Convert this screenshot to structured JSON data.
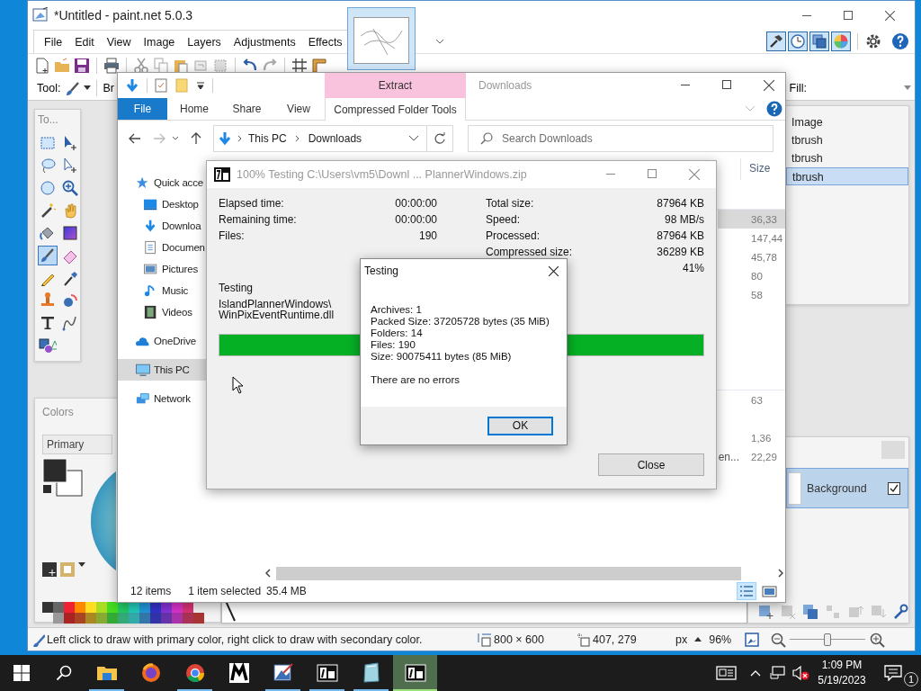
{
  "paint_window": {
    "title": "*Untitled - paint.net 5.0.3",
    "menu": [
      "File",
      "Edit",
      "View",
      "Image",
      "Layers",
      "Adjustments",
      "Effects"
    ],
    "panel_toggles": [
      {
        "kind": "tools",
        "on": true
      },
      {
        "kind": "history",
        "on": true
      },
      {
        "kind": "layers",
        "on": true
      },
      {
        "kind": "colors",
        "on": true
      }
    ],
    "tool_label": "Tool:",
    "brush_label": "Br",
    "fill_label": "Fill:",
    "tools_panel": {
      "title": "To...",
      "tools": [
        {
          "kind": "marquee",
          "selected": false
        },
        {
          "kind": "move",
          "selected": false
        },
        {
          "kind": "lasso",
          "selected": false
        },
        {
          "kind": "moveselection",
          "selected": false
        },
        {
          "kind": "ellipse",
          "selected": false
        },
        {
          "kind": "zoom",
          "selected": false
        },
        {
          "kind": "wand",
          "selected": false
        },
        {
          "kind": "pan",
          "selected": false
        },
        {
          "kind": "bucket",
          "selected": false
        },
        {
          "kind": "gradient",
          "selected": false
        },
        {
          "kind": "brush",
          "selected": true
        },
        {
          "kind": "eraser",
          "selected": false
        },
        {
          "kind": "pencil",
          "selected": false
        },
        {
          "kind": "picker",
          "selected": false
        },
        {
          "kind": "stamp",
          "selected": false
        },
        {
          "kind": "recolor",
          "selected": false
        },
        {
          "kind": "text",
          "selected": false
        },
        {
          "kind": "line",
          "selected": false
        },
        {
          "kind": "shapes",
          "selected": false
        }
      ]
    },
    "colors_panel": {
      "title": "Colors",
      "mode": "Primary"
    },
    "history": [
      {
        "label": "Image",
        "selected": false
      },
      {
        "label": "tbrush",
        "selected": false
      },
      {
        "label": "tbrush",
        "selected": false
      },
      {
        "label": "tbrush",
        "selected": true
      }
    ],
    "layers": [
      {
        "name": "Background",
        "visible": true,
        "selected": true
      }
    ],
    "status": {
      "hint": "Left click to draw with primary color, right click to draw with secondary color.",
      "image_size": "800 × 600",
      "cursor_position": "407, 279",
      "unit": "px",
      "zoom": "96%"
    },
    "zoom_slider": {
      "level": 0.5
    }
  },
  "explorer_window": {
    "title": "Downloads",
    "tab_group": "Extract",
    "ribbon_tabs": [
      {
        "label": "File",
        "kind": "file",
        "selected": false
      },
      {
        "label": "Home",
        "kind": "tab",
        "selected": false
      },
      {
        "label": "Share",
        "kind": "tab",
        "selected": false
      },
      {
        "label": "View",
        "kind": "tab",
        "selected": false
      },
      {
        "label": "Compressed Folder Tools",
        "kind": "context",
        "selected": false
      }
    ],
    "path": [
      "This PC",
      "Downloads"
    ],
    "search": {
      "placeholder": "Search Downloads"
    },
    "nav": [
      {
        "label": "Quick acce",
        "kind": "star",
        "selected": false,
        "children": [
          {
            "label": "Desktop",
            "kind": "desktop",
            "selected": false
          },
          {
            "label": "Downloa",
            "kind": "download",
            "selected": false
          },
          {
            "label": "Documen",
            "kind": "document",
            "selected": false
          },
          {
            "label": "Pictures",
            "kind": "pictures",
            "selected": false
          },
          {
            "label": "Music",
            "kind": "music",
            "selected": false
          },
          {
            "label": "Videos",
            "kind": "videos",
            "selected": false
          }
        ]
      },
      {
        "label": "OneDrive",
        "kind": "cloud",
        "selected": false
      },
      {
        "label": "This PC",
        "kind": "computer",
        "selected": true
      },
      {
        "label": "Network",
        "kind": "network",
        "selected": false
      }
    ],
    "columns": [
      {
        "label": "Size"
      }
    ],
    "groups": [
      {
        "rows": [
          {
            "size": "36,33",
            "selected": true
          },
          {
            "size": "147,44",
            "selected": false
          },
          {
            "size": "45,78",
            "selected": false
          },
          {
            "size": "80",
            "selected": false
          },
          {
            "size": "58",
            "selected": false
          },
          {
            "selected": false
          },
          {
            "selected": false
          },
          {
            "selected": false
          }
        ]
      },
      {
        "rows": [
          {
            "size": "63",
            "selected": false
          },
          {
            "selected": false
          },
          {
            "size": "1,36",
            "selected": false
          },
          {
            "name": "en...",
            "size": "22,29",
            "selected": false
          }
        ]
      }
    ],
    "status": {
      "count": "12 items",
      "selection": "1 item selected",
      "selection_size": "35.4 MB"
    },
    "view_modes": [
      {
        "kind": "details",
        "selected": true
      },
      {
        "kind": "icons",
        "selected": false
      }
    ]
  },
  "sevenzip_window": {
    "title": "100% Testing C:\\Users\\vm5\\Downl ... PlannerWindows.zip",
    "left_stats": [
      {
        "label": "Elapsed time:",
        "value": "00:00:00"
      },
      {
        "label": "Remaining time:",
        "value": "00:00:00"
      },
      {
        "label": "Files:",
        "value": "190"
      }
    ],
    "right_stats": [
      {
        "label": "Total size:",
        "value": "87964 KB"
      },
      {
        "label": "Speed:",
        "value": "98 MB/s"
      },
      {
        "label": "Processed:",
        "value": "87964 KB"
      },
      {
        "label": "Compressed size:",
        "value": "36289 KB"
      },
      {
        "value": "41%"
      }
    ],
    "operation": "Testing",
    "current_file": [
      "IslandPlannerWindows\\",
      "WinPixEventRuntime.dll"
    ],
    "progress": {
      "level": 1
    },
    "buttons": [
      "Close"
    ]
  },
  "testing_dialog": {
    "title": "Testing",
    "lines": [
      "Archives: 1",
      "Packed Size: 37205728 bytes (35 MiB)",
      "Folders: 14",
      "Files: 190",
      "Size: 90075411 bytes (85 MiB)"
    ],
    "message": "There are no errors",
    "buttons": [
      {
        "label": "OK",
        "default": true
      }
    ]
  },
  "taskbar": {
    "apps": [
      {
        "kind": "explorer",
        "running": true,
        "active": false
      },
      {
        "kind": "firefox",
        "running": false,
        "active": false
      },
      {
        "kind": "chrome",
        "running": true,
        "active": false
      },
      {
        "kind": "mapp",
        "running": false,
        "active": false
      },
      {
        "kind": "paintnet",
        "running": true,
        "active": false
      },
      {
        "kind": "sevenzip",
        "running": true,
        "active": false
      },
      {
        "kind": "notepad",
        "running": true,
        "active": false
      },
      {
        "kind": "sevenzip",
        "running": true,
        "active": true
      }
    ],
    "volume_muted": true,
    "time": "1:09 PM",
    "date": "5/19/2023",
    "notifications": "1"
  }
}
